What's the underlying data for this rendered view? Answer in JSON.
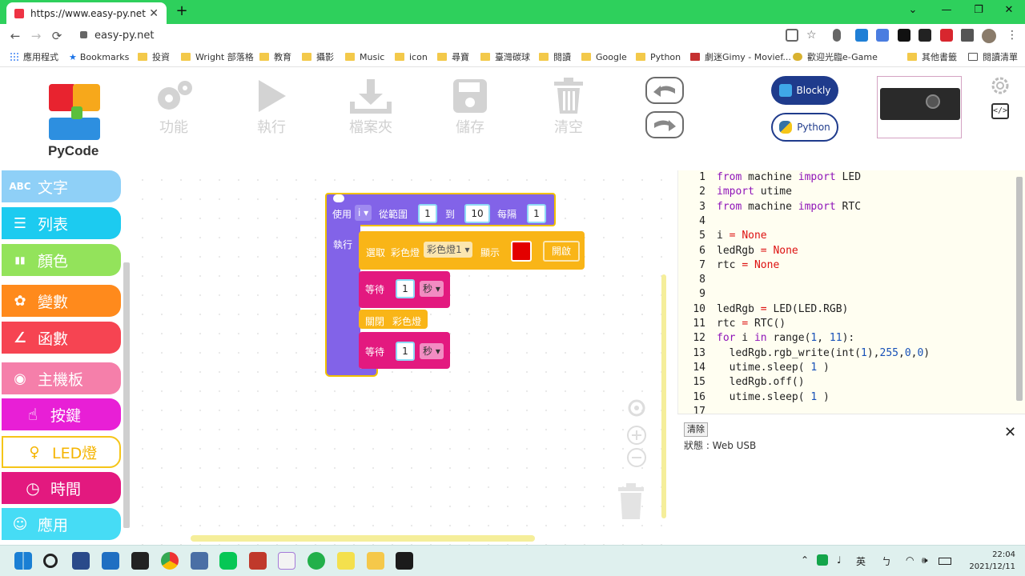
{
  "browser": {
    "tab_title": "https://www.easy-py.net",
    "tab_close": "✕",
    "new_tab": "+",
    "url": "easy-py.net",
    "window_controls": [
      "⌄",
      "—",
      "❐",
      "✕"
    ],
    "nav": [
      "←",
      "→",
      "⟳"
    ]
  },
  "bookmarks": [
    "應用程式",
    "Bookmarks",
    "投資",
    "Wright 部落格",
    "教育",
    "攝影",
    "Music",
    "icon",
    "尋寶",
    "臺灣碳球",
    "閱讀",
    "Google",
    "Python",
    "劇迷Gimy - Movief...",
    "歡迎光臨e-Game",
    "其他書籤",
    "閱讀清單"
  ],
  "app": {
    "logo_text": "PyCode",
    "tools": [
      {
        "label": "功能",
        "icon": "gear-icon"
      },
      {
        "label": "執行",
        "icon": "play-icon"
      },
      {
        "label": "檔案夾",
        "icon": "download-icon"
      },
      {
        "label": "儲存",
        "icon": "save-icon"
      },
      {
        "label": "清空",
        "icon": "trash-icon"
      }
    ],
    "blockly_label": "Blockly",
    "python_label": "Python",
    "code_toggle": "</>"
  },
  "categories": [
    {
      "label": "文字",
      "icon": "ABC",
      "color": "#8fd0f7"
    },
    {
      "label": "列表",
      "icon": "☰",
      "color": "#1ccbf0"
    },
    {
      "label": "顏色",
      "icon": "▮▮",
      "color": "#93e35b"
    },
    {
      "label": "變數",
      "icon": "✿",
      "color": "#ff8a1c"
    },
    {
      "label": "函數",
      "icon": "∠",
      "color": "#f64452"
    },
    {
      "label": "主機板",
      "icon": "◉",
      "color": "#f57faa"
    },
    {
      "label": "按鍵",
      "icon": "☝",
      "color": "#e81fd6"
    },
    {
      "label": "LED燈",
      "icon": "♀",
      "color": "#ffffff"
    },
    {
      "label": "時間",
      "icon": "◷",
      "color": "#e3197f"
    },
    {
      "label": "應用",
      "icon": "☺",
      "color": "#46dcf5"
    }
  ],
  "blocks": {
    "loop": {
      "use": "使用",
      "var": "i",
      "from": "從範圍",
      "start": "1",
      "to": "到",
      "end": "10",
      "step_label": "每隔",
      "step": "1",
      "do": "執行"
    },
    "set_led": {
      "pick": "選取",
      "led_label": "彩色燈",
      "led_name": "彩色燈1",
      "show": "顯示",
      "on": "開啟"
    },
    "wait1": {
      "label": "等待",
      "value": "1",
      "unit": "秒"
    },
    "off": {
      "label": "關閉",
      "target": "彩色燈"
    },
    "wait2": {
      "label": "等待",
      "value": "1",
      "unit": "秒"
    }
  },
  "editor": {
    "lines": [
      "from machine import LED",
      "import utime",
      "from machine import RTC",
      "",
      "i = None",
      "ledRgb = None",
      "rtc = None",
      "",
      "",
      "ledRgb = LED(LED.RGB)",
      "rtc = RTC()",
      "for i in range(1, 11):",
      "  ledRgb.rgb_write(int(1),255,0,0)",
      "  utime.sleep( 1 )",
      "  ledRgb.off()",
      "  utime.sleep( 1 )",
      ""
    ]
  },
  "console": {
    "clear_label": "清除",
    "status_text": "狀態 : Web USB",
    "close": "✕"
  },
  "taskbar": {
    "ime": "英",
    "time": "22:04",
    "date": "2021/12/11"
  }
}
